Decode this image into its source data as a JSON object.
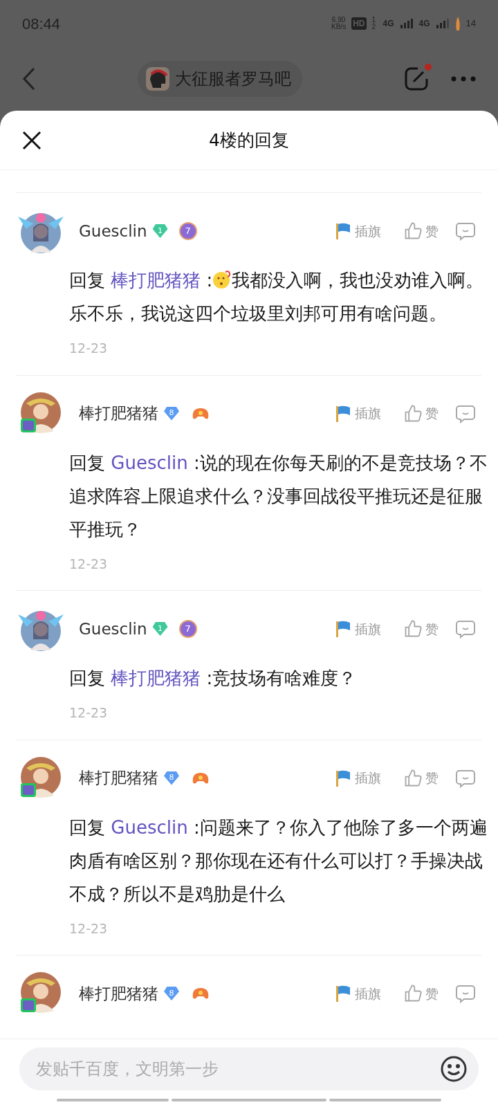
{
  "status_bar": {
    "time": "08:44",
    "speed": "6.90",
    "speed_unit": "KB/s",
    "hd": "HD",
    "sim_slots": "1 2",
    "network_1": "4G",
    "network_2": "4G",
    "battery": "14"
  },
  "forum_bar": {
    "forum_name": "大征服者罗马吧",
    "has_notification": true
  },
  "sheet": {
    "title": "4楼的回复"
  },
  "replies": [
    {
      "user": "Guesclin",
      "level": "1",
      "color": "#3ec99a",
      "medal": "7",
      "kind": "angel",
      "prefix": "回复",
      "mention": "棒打肥猪猪",
      "segments": [
        {
          "kind": "text",
          "text": " :"
        },
        {
          "kind": "emoji"
        },
        {
          "kind": "text",
          "text": "我都没入啊，我也没劝谁入啊。乐不乐，我说这四个垃圾里刘邦可用有啥问题。"
        }
      ],
      "date": "12-23",
      "flag": "插旗",
      "like": "赞"
    },
    {
      "user": "棒打肥猪猪",
      "level": "8",
      "color": "#5b9cf2",
      "kind": "laurel",
      "prefix": "回复",
      "mention": "Guesclin",
      "segments": [
        {
          "kind": "text",
          "text": " :说的现在你每天刷的不是竞技场？不追求阵容上限追求什么？没事回战役平推玩还是征服平推玩？"
        }
      ],
      "date": "12-23",
      "flag": "插旗",
      "like": "赞"
    },
    {
      "user": "Guesclin",
      "level": "1",
      "color": "#3ec99a",
      "medal": "7",
      "kind": "angel",
      "prefix": "回复",
      "mention": "棒打肥猪猪",
      "segments": [
        {
          "kind": "text",
          "text": " :竞技场有啥难度？"
        }
      ],
      "date": "12-23",
      "flag": "插旗",
      "like": "赞"
    },
    {
      "user": "棒打肥猪猪",
      "level": "8",
      "color": "#5b9cf2",
      "kind": "laurel",
      "prefix": "回复",
      "mention": "Guesclin",
      "segments": [
        {
          "kind": "text",
          "text": " :问题来了？你入了他除了多一个两遍肉盾有啥区别？那你现在还有什么可以打？手操决战不成？所以不是鸡肋是什么"
        }
      ],
      "date": "12-23",
      "flag": "插旗",
      "like": "赞"
    },
    {
      "user": "棒打肥猪猪",
      "level": "8",
      "color": "#5b9cf2",
      "kind": "laurel",
      "flag": "插旗",
      "like": "赞"
    }
  ],
  "composer": {
    "placeholder": "发贴千百度，文明第一步"
  }
}
